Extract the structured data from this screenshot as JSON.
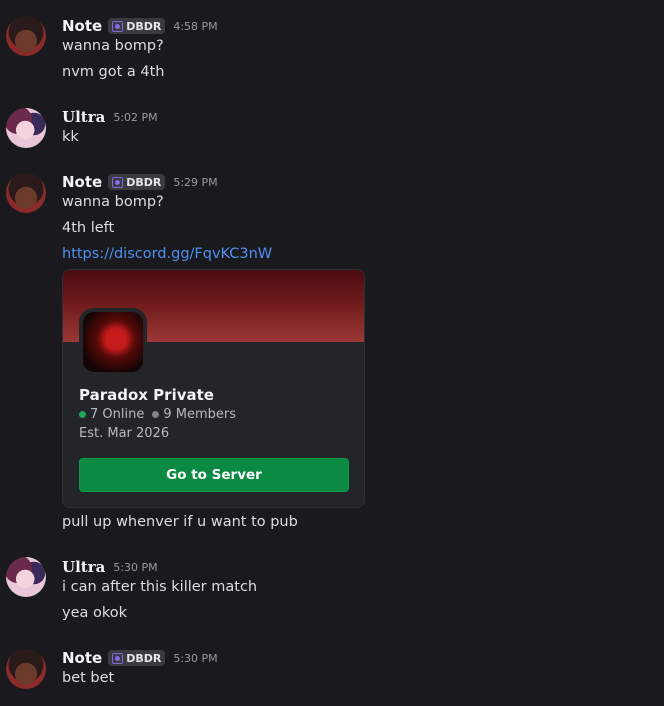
{
  "users": {
    "note": {
      "name": "Note",
      "tag": "DBDR",
      "tag_color": "#8c6cf0"
    },
    "ultra": {
      "name": "Ultra"
    }
  },
  "messages": [
    {
      "author": "Note",
      "time": "4:58 PM",
      "lines": [
        "wanna bomp?",
        "nvm got a 4th"
      ]
    },
    {
      "author": "Ultra",
      "time": "5:02 PM",
      "lines": [
        "kk"
      ]
    },
    {
      "author": "Note",
      "time": "5:29 PM",
      "lines": [
        "wanna bomp?",
        "4th left",
        "https://discord.gg/FqvKC3nW",
        "pull up whenver if u want to pub"
      ]
    },
    {
      "author": "Ultra",
      "time": "5:30 PM",
      "lines": [
        "i can after this killer match",
        "yea okok"
      ]
    },
    {
      "author": "Note",
      "time": "5:30 PM",
      "lines": [
        "bet bet"
      ]
    }
  ],
  "invite": {
    "server_name": "Paradox Private",
    "online": "7 Online",
    "members": "9 Members",
    "established": "Est. Mar 2026",
    "button_label": "Go to Server",
    "online_color": "#23a559",
    "button_color": "#0b8a43",
    "banner_color": "#6e1a1c"
  },
  "colors": {
    "background": "#1a1a1e",
    "link": "#4e8ff0"
  }
}
